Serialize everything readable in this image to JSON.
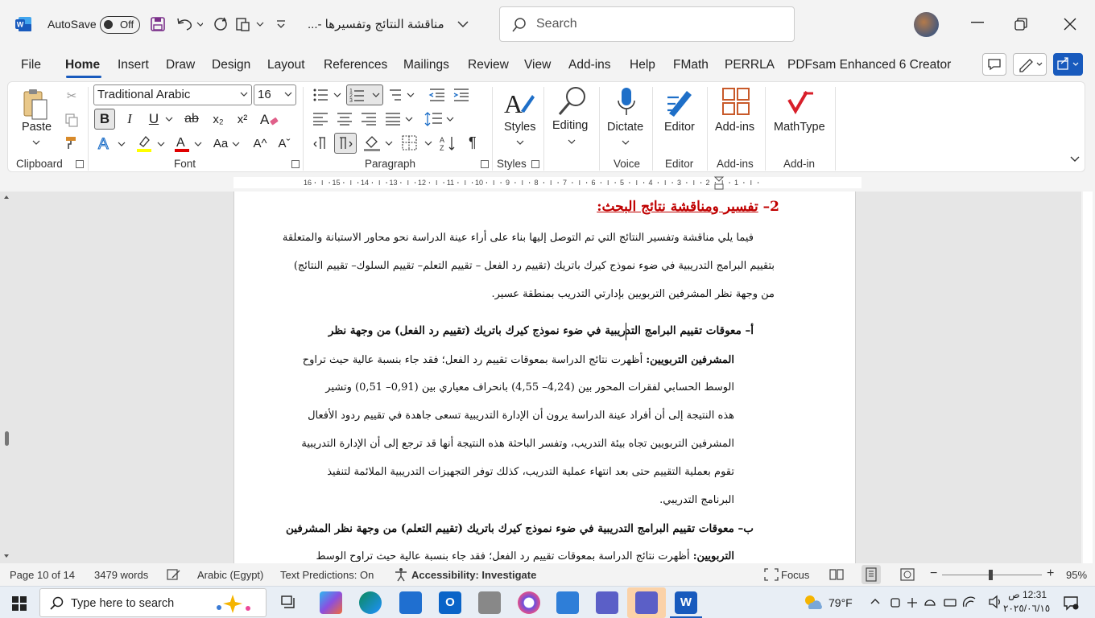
{
  "titlebar": {
    "autosave_label": "AutoSave",
    "autosave_state": "Off",
    "doc_title": "...- مناقشة النتائج وتفسيرها",
    "search_placeholder": "Search"
  },
  "menu": {
    "items": [
      "File",
      "Home",
      "Insert",
      "Draw",
      "Design",
      "Layout",
      "References",
      "Mailings",
      "Review",
      "View",
      "Add-ins",
      "Help",
      "FMath",
      "PERRLA",
      "PDFsam Enhanced 6 Creator"
    ],
    "active": "Home"
  },
  "ribbon": {
    "clipboard": {
      "paste_label": "Paste",
      "group_label": "Clipboard"
    },
    "font": {
      "font_name": "Traditional Arabic",
      "font_size": "16",
      "group_label": "Font",
      "bold": "B",
      "italic": "I",
      "underline": "U",
      "strike": "ab",
      "subscript": "x₂",
      "superscript": "x²",
      "change_case": "Aa",
      "grow": "A^",
      "shrink": "Aˇ"
    },
    "paragraph": {
      "group_label": "Paragraph"
    },
    "styles": {
      "label": "Styles",
      "group_label": "Styles"
    },
    "editing": {
      "label": "Editing"
    },
    "voice": {
      "label": "Dictate",
      "group_label": "Voice"
    },
    "editor": {
      "label": "Editor",
      "group_label": "Editor"
    },
    "addins": {
      "label": "Add-ins",
      "group_label": "Add-ins"
    },
    "mathtype": {
      "label": "MathType",
      "group_label": "Add-in"
    }
  },
  "ruler": {
    "labels": [
      "16",
      "15",
      "14",
      "13",
      "12",
      "11",
      "10",
      "9",
      "8",
      "7",
      "6",
      "5",
      "4",
      "3",
      "2",
      "1"
    ]
  },
  "document": {
    "heading_num": "2–",
    "heading": "تفسير ومناقشة نتائج البحث:",
    "intro_lines": [
      "فيما يلي مناقشة وتفسير النتائج التي تم التوصل إليها بناء على أراء عينة الدراسة نحو محاور الاستبانة والمتعلقة",
      "بتقييم البرامج التدريبية في ضوء نموذج كيرك باتريك (تقييم رد الفعل – تقييم التعلم– تقييم السلوك– تقييم النتائج)",
      "من وجهة نظر المشرفين التربويين بإدارتي التدريب بمنطقة عسير."
    ],
    "section_a_title_line1": "أ– معوقات تقييم البرامج التدريبية في ضوء نموذج كيرك باتريك (تقييم رد الفعل) من وجهة نظر",
    "section_a_bold_start": "المشرفين التربويين:",
    "section_a_lines": [
      "أظهرت نتائج الدراسة بمعوقات تقييم رد الفعل؛ فقد جاء بنسبة عالية حيث تراوح",
      "الوسط الحسابي لفقرات المحور بين (4,24– 4,55) بانحراف معياري بين (0,91– 0,51) وتشير",
      "هذه النتيجة إلى أن أفراد عينة الدراسة يرون أن الإدارة التدريبية تسعى جاهدة في تقييم ردود الأفعال",
      "المشرفين التربويين تجاه بيئة التدريب، وتفسر الباحثة هذه النتيجة أنها قد ترجع إلى أن الإدارة التدريبية",
      "تقوم بعملية التقييم حتى بعد انتهاء عملية التدريب، كذلك توفر التجهيزات التدريبية الملائمة لتنفيذ",
      "البرنامج التدريبي."
    ],
    "section_b_title_line1": "ب– معوقات تقييم البرامج التدريبية في ضوء نموذج كيرك باتريك (تقييم التعلم) من وجهة نظر المشرفين",
    "section_b_bold_start": "التربويين:",
    "section_b_line": "أظهرت نتائج الدراسة بمعوقات تقييم رد الفعل؛ فقد جاء بنسبة عالية حيث تراوح الوسط"
  },
  "status": {
    "page": "Page 10 of 14",
    "words": "3479 words",
    "language": "Arabic (Egypt)",
    "predictions": "Text Predictions: On",
    "accessibility": "Accessibility: Investigate",
    "focus": "Focus",
    "zoom": "95%"
  },
  "taskbar": {
    "search_placeholder": "Type here to search",
    "temperature": "79°F",
    "time": "12:31 ص",
    "date": "٢٠٢٥/٠٦/١٥"
  }
}
